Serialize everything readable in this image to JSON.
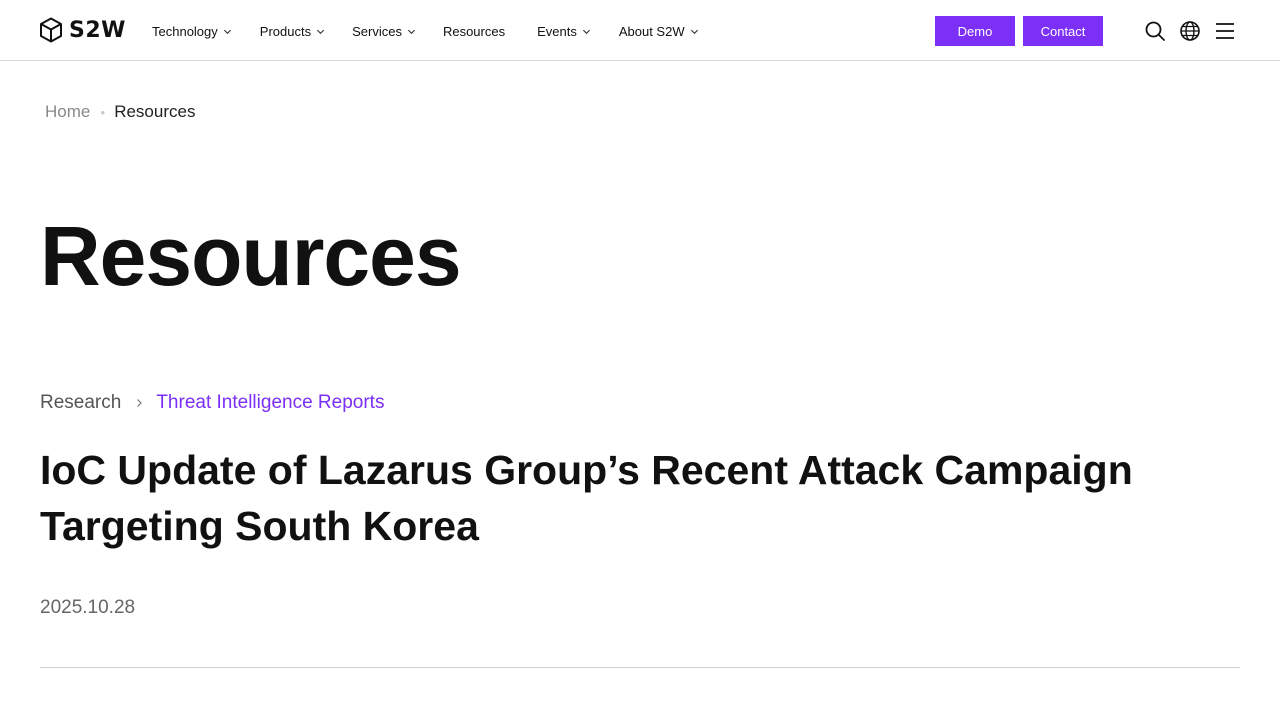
{
  "header": {
    "logo_text": "S2W",
    "nav": [
      {
        "label": "Technology",
        "has_dropdown": true
      },
      {
        "label": "Products",
        "has_dropdown": true
      },
      {
        "label": "Services",
        "has_dropdown": true
      },
      {
        "label": "Resources",
        "has_dropdown": false
      },
      {
        "label": "Events",
        "has_dropdown": true
      },
      {
        "label": "About S2W",
        "has_dropdown": true
      }
    ],
    "demo_label": "Demo",
    "contact_label": "Contact",
    "icons": [
      "search-icon",
      "globe-icon",
      "menu-icon"
    ]
  },
  "breadcrumb": {
    "home": "Home",
    "current": "Resources"
  },
  "page_title": "Resources",
  "article": {
    "category": "Research",
    "subcategory": "Threat Intelligence Reports",
    "title": "IoC Update of Lazarus Group’s Recent Attack Campaign Targeting South Korea",
    "date": "2025.10.28"
  },
  "colors": {
    "accent": "#7b2ff7",
    "text": "#111111",
    "muted": "#8a8a8a",
    "divider": "#cfcfcf"
  }
}
